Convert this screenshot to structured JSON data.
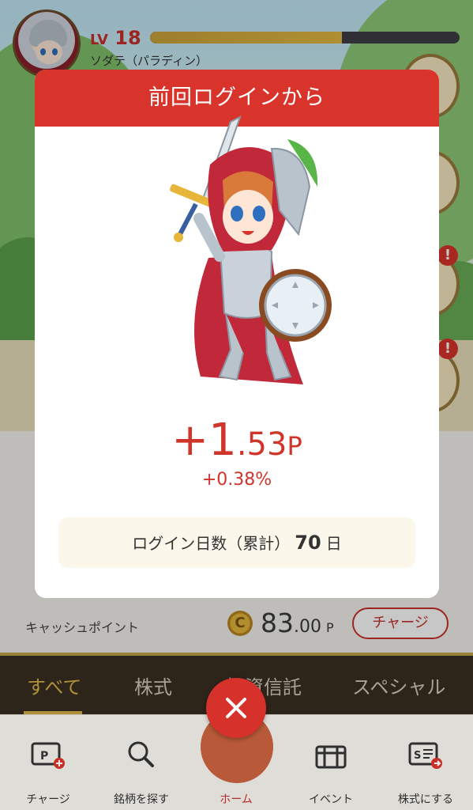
{
  "header": {
    "level_label": "LV",
    "level": "18",
    "exp_progress": 0.62,
    "character_name": "ソダテ（パラディン）"
  },
  "alerts": [
    "!",
    "!"
  ],
  "modal": {
    "title": "前回ログインから",
    "gain_sign_int": "+1",
    "gain_decimal": ".53",
    "gain_unit": "P",
    "gain_percent": "+0.38%",
    "login_label": "ログイン日数（累計）",
    "login_days": "70",
    "login_unit": "日"
  },
  "cash": {
    "label": "キャッシュポイント",
    "coin_symbol": "C",
    "value_int": "83",
    "value_dec": ".00",
    "unit": "P",
    "charge_button": "チャージ"
  },
  "tabs": [
    "すべて",
    "株式",
    "投資信託",
    "スペシャル"
  ],
  "nav": {
    "charge": "チャージ",
    "search": "銘柄を探す",
    "home": "ホーム",
    "event": "イベント",
    "stock": "株式にする"
  },
  "colors": {
    "accent_red": "#d8342b",
    "gold": "#e2b94a",
    "tab_bar": "#3a2f22"
  }
}
